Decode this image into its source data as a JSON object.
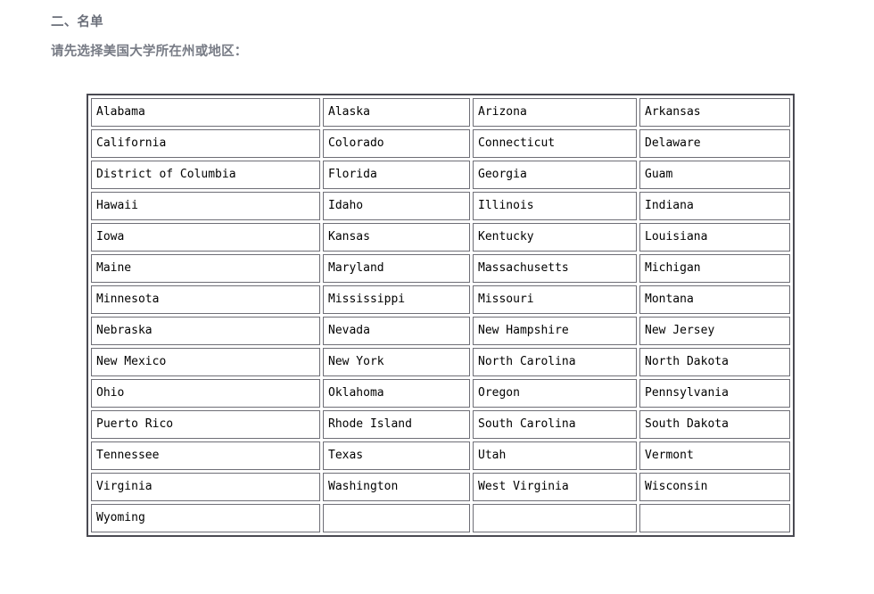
{
  "document": {
    "section_title": "二、名单",
    "prompt": "请先选择美国大学所在州或地区：",
    "text_color": "#6b6f7a",
    "table_border_color": "#4a4a52",
    "cell_border_color": "#6e6e76",
    "cell_text_color": "#000000",
    "background": "#ffffff"
  },
  "state_table": {
    "columns": 4,
    "rows": 15,
    "cells": [
      [
        "Alabama",
        "Alaska",
        "Arizona",
        "Arkansas"
      ],
      [
        "California",
        "Colorado",
        "Connecticut",
        "Delaware"
      ],
      [
        "District of Columbia",
        "Florida",
        "Georgia",
        "Guam"
      ],
      [
        "Hawaii",
        "Idaho",
        "Illinois",
        "Indiana"
      ],
      [
        "Iowa",
        "Kansas",
        "Kentucky",
        "Louisiana"
      ],
      [
        "Maine",
        "Maryland",
        "Massachusetts",
        "Michigan"
      ],
      [
        "Minnesota",
        "Mississippi",
        "Missouri",
        "Montana"
      ],
      [
        "Nebraska",
        "Nevada",
        "New Hampshire",
        "New Jersey"
      ],
      [
        "New Mexico",
        "New York",
        "North Carolina",
        "North Dakota"
      ],
      [
        "Ohio",
        "Oklahoma",
        "Oregon",
        "Pennsylvania"
      ],
      [
        "Puerto Rico",
        "Rhode Island",
        "South Carolina",
        "South Dakota"
      ],
      [
        "Tennessee",
        "Texas",
        "Utah",
        "Vermont"
      ],
      [
        "Virginia",
        "Washington",
        "West Virginia",
        "Wisconsin"
      ],
      [
        "Wyoming",
        "",
        "",
        ""
      ]
    ]
  }
}
